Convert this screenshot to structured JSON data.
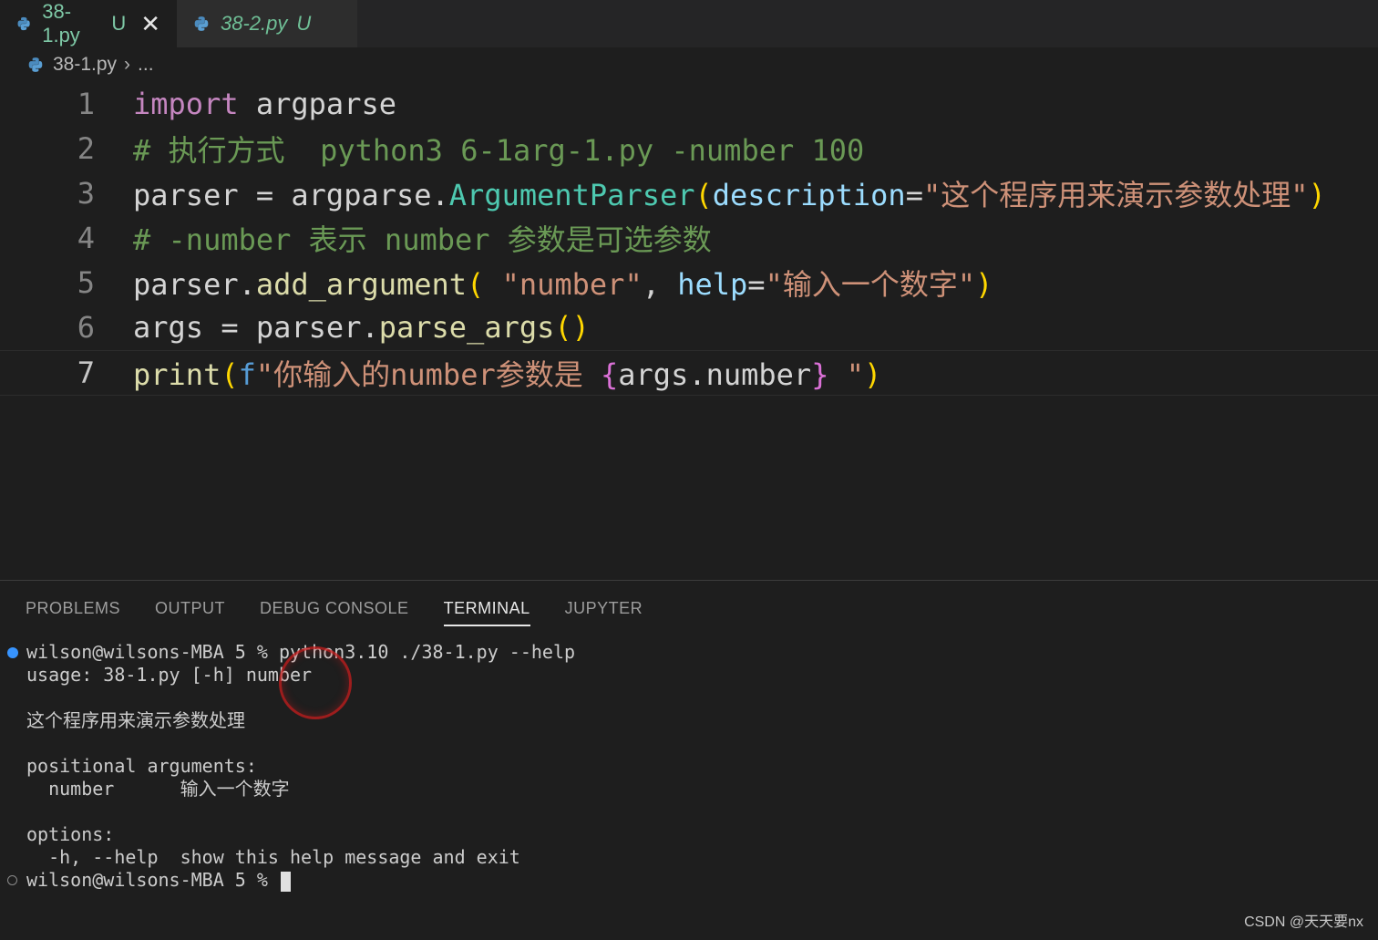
{
  "tabs": [
    {
      "label": "38-1.py",
      "status": "U",
      "active": true,
      "close": "✕"
    },
    {
      "label": "38-2.py",
      "status": "U",
      "active": false
    }
  ],
  "breadcrumb": {
    "file": "38-1.py",
    "separator": "›",
    "more": "..."
  },
  "editor": {
    "line_numbers": [
      "1",
      "2",
      "3",
      "4",
      "5",
      "6",
      "7"
    ],
    "l1": {
      "kw": "import",
      "rest": " argparse"
    },
    "l2": {
      "comment": "# 执行方式  python3 6-1arg-1.py -number 100"
    },
    "l3": {
      "a": "parser = argparse.",
      "cls": "ArgumentParser",
      "paren_open": "(",
      "param": "description",
      "eq": "=",
      "str": "\"这个程序用来演示参数处理\"",
      "paren_close": ")"
    },
    "l4": {
      "comment": "# -number 表示 number 参数是可选参数"
    },
    "l5": {
      "a": "parser.",
      "fn": "add_argument",
      "paren_open": "(",
      "sp": " ",
      "str1": "\"number\"",
      "comma": ", ",
      "param": "help",
      "eq": "=",
      "str2": "\"输入一个数字\"",
      "paren_close": ")"
    },
    "l6": {
      "a": "args = parser.",
      "fn": "parse_args",
      "parens": "()"
    },
    "l7": {
      "fn": "print",
      "paren_open": "(",
      "fpre": "f",
      "str1": "\"你输入的number参数是 ",
      "brace_open": "{",
      "expr": "args.number",
      "brace_close": "}",
      "str2": " \"",
      "paren_close": ")"
    }
  },
  "panel": {
    "tabs": [
      "PROBLEMS",
      "OUTPUT",
      "DEBUG CONSOLE",
      "TERMINAL",
      "JUPYTER"
    ],
    "active_tab": "TERMINAL"
  },
  "terminal": {
    "lines": [
      "wilson@wilsons-MBA 5 % python3.10 ./38-1.py --help",
      "usage: 38-1.py [-h] number",
      "",
      "这个程序用来演示参数处理",
      "",
      "positional arguments:",
      "  number      输入一个数字",
      "",
      "options:",
      "  -h, --help  show this help message and exit",
      "wilson@wilsons-MBA 5 % "
    ]
  },
  "watermark": "CSDN @天天要nx",
  "colors": {
    "background": "#1e1e1e",
    "keyword": "#c586c0",
    "string": "#ce9178",
    "comment": "#6a9955",
    "function": "#dcdcaa",
    "parameter": "#9cdcfe",
    "terminal_dot": "#3794ff"
  }
}
